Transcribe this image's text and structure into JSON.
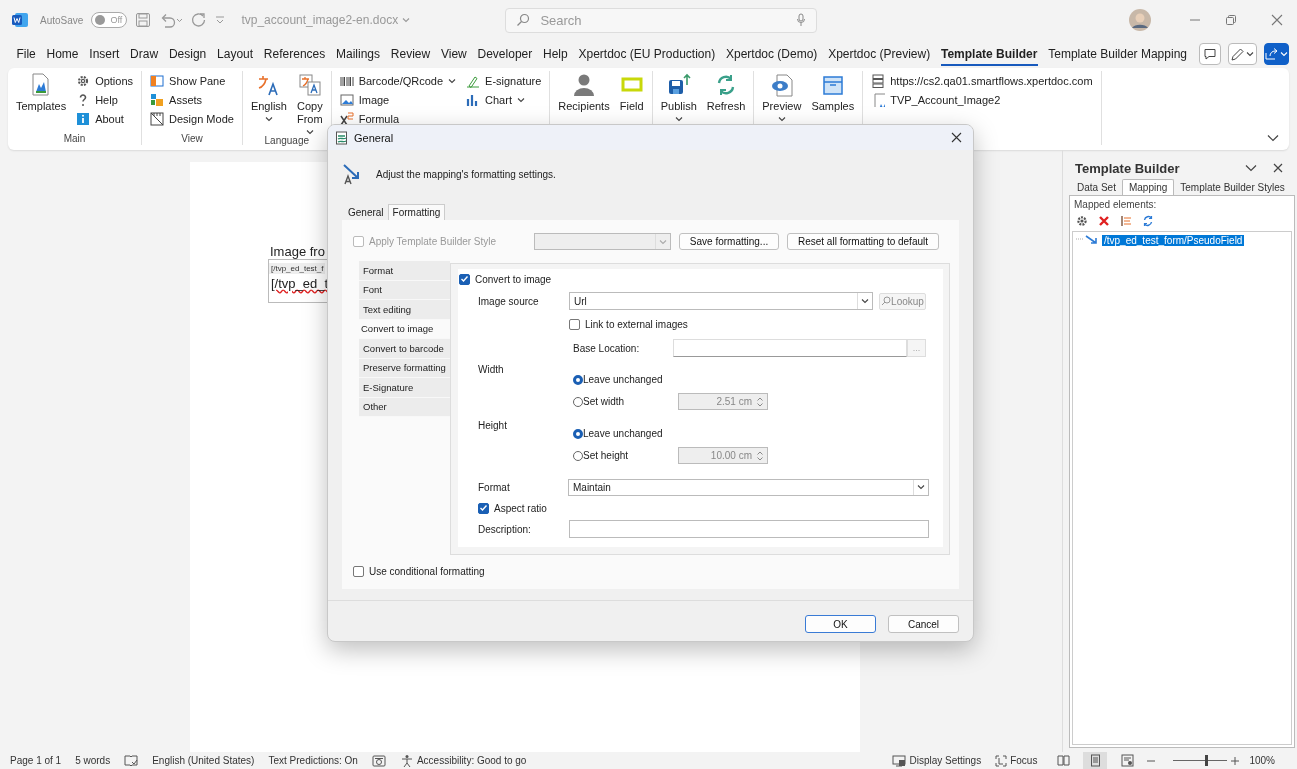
{
  "titlebar": {
    "autosave_label": "AutoSave",
    "autosave_toggle": {
      "label": "Off",
      "on": false
    },
    "document_title": "tvp_account_image2-en.docx",
    "search": {
      "placeholder": "Search"
    }
  },
  "menu_tabs": [
    {
      "label": "File",
      "selected": false
    },
    {
      "label": "Home",
      "selected": false
    },
    {
      "label": "Insert",
      "selected": false
    },
    {
      "label": "Draw",
      "selected": false
    },
    {
      "label": "Design",
      "selected": false
    },
    {
      "label": "Layout",
      "selected": false
    },
    {
      "label": "References",
      "selected": false
    },
    {
      "label": "Mailings",
      "selected": false
    },
    {
      "label": "Review",
      "selected": false
    },
    {
      "label": "View",
      "selected": false
    },
    {
      "label": "Developer",
      "selected": false
    },
    {
      "label": "Help",
      "selected": false
    },
    {
      "label": "Xpertdoc (EU Production)",
      "selected": false
    },
    {
      "label": "Xpertdoc (Demo)",
      "selected": false
    },
    {
      "label": "Xpertdoc (Preview)",
      "selected": false
    },
    {
      "label": "Template Builder",
      "selected": true
    },
    {
      "label": "Template Builder Mapping",
      "selected": false
    }
  ],
  "ribbon_groups": [
    {
      "label": "Main",
      "columns": [
        [
          {
            "label": "Templates",
            "kind": "large"
          }
        ],
        [
          {
            "label": "Options",
            "kind": "small"
          },
          {
            "label": "Help",
            "kind": "small"
          },
          {
            "label": "About",
            "kind": "small"
          }
        ]
      ]
    },
    {
      "label": "View",
      "columns": [
        [
          {
            "label": "Show Pane",
            "kind": "small"
          },
          {
            "label": "Assets",
            "kind": "small"
          },
          {
            "label": "Design Mode",
            "kind": "small"
          }
        ]
      ]
    },
    {
      "label": "Language",
      "columns": [
        [
          {
            "label": "English",
            "kind": "large",
            "caret": true
          }
        ],
        [
          {
            "label": "Copy From",
            "kind": "large",
            "caret": true
          }
        ]
      ]
    },
    {
      "columns": [
        [
          {
            "label": "Barcode/QRcode",
            "kind": "small",
            "caret": true
          },
          {
            "label": "Image",
            "kind": "small"
          },
          {
            "label": "Formula",
            "kind": "small"
          }
        ],
        [
          {
            "label": "E-signature",
            "kind": "small"
          },
          {
            "label": "Chart",
            "kind": "small",
            "caret": true
          }
        ]
      ]
    },
    {
      "columns": [
        [
          {
            "label": "Recipients",
            "kind": "large"
          }
        ],
        [
          {
            "label": "Field",
            "kind": "large"
          }
        ]
      ]
    },
    {
      "columns": [
        [
          {
            "label": "Publish",
            "kind": "large",
            "caret": true
          }
        ],
        [
          {
            "label": "Refresh",
            "kind": "large"
          }
        ]
      ]
    },
    {
      "columns": [
        [
          {
            "label": "Preview",
            "kind": "large",
            "caret": true
          }
        ],
        [
          {
            "label": "Samples",
            "kind": "large"
          }
        ]
      ]
    },
    {
      "columns": [
        [
          {
            "label": "https://cs2.qa01.smartflows.xpertdoc.com",
            "kind": "small"
          },
          {
            "label": "TVP_Account_Image2",
            "kind": "small"
          }
        ]
      ]
    }
  ],
  "document": {
    "heading": "Image fro",
    "field_tag": "[/tvp_ed_test_f",
    "field_text": "[/tvp_ed_t"
  },
  "dialog": {
    "title": "General",
    "header": "Adjust the mapping's formatting settings.",
    "tabs": [
      {
        "label": "General",
        "selected": false
      },
      {
        "label": "Formatting",
        "selected": true
      }
    ],
    "apply_style": {
      "label": "Apply Template Builder Style",
      "checked": false,
      "disabled": true
    },
    "buttons_top": [
      "Save formatting...",
      "Reset all formatting to default"
    ],
    "side_tabs": [
      {
        "label": "Format",
        "selected": false
      },
      {
        "label": "Font",
        "selected": false
      },
      {
        "label": "Text editing",
        "selected": false
      },
      {
        "label": "Convert to image",
        "selected": true
      },
      {
        "label": "Convert to barcode",
        "selected": false
      },
      {
        "label": "Preserve formatting",
        "selected": false
      },
      {
        "label": "E-Signature",
        "selected": false
      },
      {
        "label": "Other",
        "selected": false
      }
    ],
    "convert_to_image": {
      "label": "Convert to image",
      "checked": true
    },
    "image_source": {
      "label": "Image source",
      "value": "Url",
      "lookup": "Lookup"
    },
    "link_external": {
      "label": "Link to external images",
      "checked": false
    },
    "base_location": {
      "label": "Base Location:",
      "button": "..."
    },
    "width": {
      "label": "Width",
      "options": [
        {
          "label": "Leave unchanged",
          "selected": true
        },
        {
          "label": "Set width",
          "selected": false
        }
      ],
      "value": "2.51 cm"
    },
    "height": {
      "label": "Height",
      "options": [
        {
          "label": "Leave unchanged",
          "selected": true
        },
        {
          "label": "Set height",
          "selected": false
        }
      ],
      "value": "10.00 cm"
    },
    "format": {
      "label": "Format",
      "value": "Maintain"
    },
    "aspect_ratio": {
      "label": "Aspect ratio",
      "checked": true
    },
    "description": {
      "label": "Description:"
    },
    "conditional": {
      "label": "Use conditional formatting",
      "checked": false
    },
    "buttons": [
      "OK",
      "Cancel"
    ]
  },
  "pane": {
    "title": "Template Builder",
    "tabs": [
      {
        "label": "Data Set",
        "selected": false
      },
      {
        "label": "Mapping",
        "selected": true
      },
      {
        "label": "Template Builder Styles",
        "selected": false
      }
    ],
    "mapped_label": "Mapped elements:",
    "tree": [
      {
        "label": "/tvp_ed_test_form/PseudoField",
        "selected": true
      }
    ]
  },
  "status_bar": {
    "left": [
      "Page 1 of 1",
      "5 words",
      "English (United States)",
      "Text Predictions: On",
      "Accessibility: Good to go"
    ],
    "display_settings": "Display Settings",
    "focus": "Focus",
    "view_modes": [
      {
        "selected": false
      },
      {
        "selected": true
      },
      {
        "selected": false
      }
    ],
    "zoom": {
      "level": 0.6,
      "reading": "100%"
    }
  }
}
